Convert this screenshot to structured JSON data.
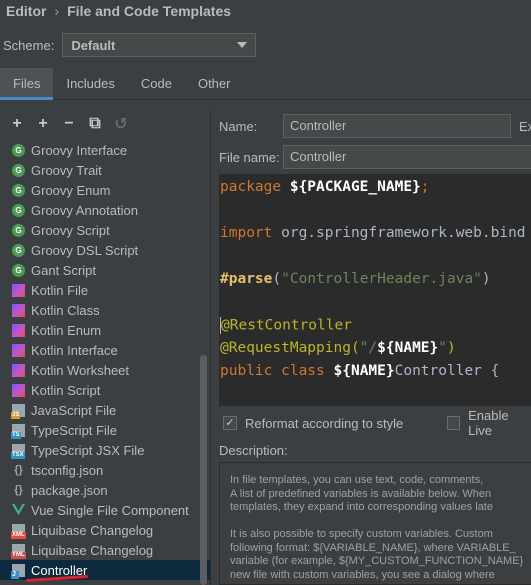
{
  "breadcrumb": {
    "section": "Editor",
    "separator": "›",
    "page": "File and Code Templates"
  },
  "scheme": {
    "label": "Scheme:",
    "value": "Default"
  },
  "tabs": [
    "Files",
    "Includes",
    "Code",
    "Other"
  ],
  "toolbar": {
    "add": "+",
    "add_child": "+",
    "remove": "−",
    "copy": "⧉",
    "reset": "↺"
  },
  "templates": [
    {
      "label": "Groovy Interface",
      "icon": "G",
      "type": "groovy"
    },
    {
      "label": "Groovy Trait",
      "icon": "G",
      "type": "groovy"
    },
    {
      "label": "Groovy Enum",
      "icon": "G",
      "type": "groovy"
    },
    {
      "label": "Groovy Annotation",
      "icon": "G",
      "type": "groovy"
    },
    {
      "label": "Groovy Script",
      "icon": "G",
      "type": "groovy"
    },
    {
      "label": "Groovy DSL Script",
      "icon": "G",
      "type": "groovy"
    },
    {
      "label": "Gant Script",
      "icon": "G",
      "type": "groovy"
    },
    {
      "label": "Kotlin File",
      "icon": "",
      "type": "kotlin"
    },
    {
      "label": "Kotlin Class",
      "icon": "",
      "type": "kotlin"
    },
    {
      "label": "Kotlin Enum",
      "icon": "",
      "type": "kotlin"
    },
    {
      "label": "Kotlin Interface",
      "icon": "",
      "type": "kotlin"
    },
    {
      "label": "Kotlin Worksheet",
      "icon": "",
      "type": "kotlin"
    },
    {
      "label": "Kotlin Script",
      "icon": "",
      "type": "kotlin"
    },
    {
      "label": "JavaScript File",
      "icon": "JS",
      "type": "js"
    },
    {
      "label": "TypeScript File",
      "icon": "TS",
      "type": "ts"
    },
    {
      "label": "TypeScript JSX File",
      "icon": "TSX",
      "type": "tsx"
    },
    {
      "label": "tsconfig.json",
      "icon": "{}",
      "type": "json"
    },
    {
      "label": "package.json",
      "icon": "{}",
      "type": "json"
    },
    {
      "label": "Vue Single File Component",
      "icon": "V",
      "type": "vue"
    },
    {
      "label": "Liquibase Changelog",
      "icon": "XML",
      "type": "xml"
    },
    {
      "label": "Liquibase Changelog",
      "icon": "YML",
      "type": "yml"
    },
    {
      "label": "Controller",
      "icon": "J",
      "type": "java",
      "selected": true
    }
  ],
  "form": {
    "name_label": "Name:",
    "name_value": "Controller",
    "extension_label": "Ex",
    "filename_label": "File name:",
    "filename_value": "Controller"
  },
  "code": {
    "line1_kw": "package ",
    "line1_var": "${PACKAGE_NAME}",
    "line1_end": ";",
    "line2_kw": "import ",
    "line2_text": "org.springframework.web.bind",
    "line3_dir": "#parse",
    "line3_open": "(",
    "line3_str": "\"ControllerHeader.java\"",
    "line3_close": ")",
    "line4": "@RestController",
    "line5_a": "@RequestMapping(",
    "line5_str": "\"/",
    "line5_var": "${NAME}",
    "line5_str2": "\"",
    "line5_b": ")",
    "line6_kw": "public class ",
    "line6_var": "${NAME}",
    "line6_text": "Controller {"
  },
  "options": {
    "reformat_label": "Reformat according to style",
    "reformat_checked": "✓",
    "live_label": "Enable Live"
  },
  "description": {
    "label": "Description:",
    "lines": [
      "In file templates, you can use text, code, comments,",
      "A list of predefined variables is available below. When",
      "templates, they expand into corresponding values late",
      "",
      "It is also possible to specify custom variables. Custom",
      "following format: ${VARIABLE_NAME}, where VARIABLE_",
      "variable (for example, ${MY_CUSTOM_FUNCTION_NAME}",
      "new file with custom variables, you see a dialog where"
    ]
  },
  "colors": {
    "accent": "#4a88c7",
    "selection": "#0d293e",
    "background": "#3c3f41",
    "editor_bg": "#2b2b2b",
    "annotation_mark": "#d8242a"
  }
}
